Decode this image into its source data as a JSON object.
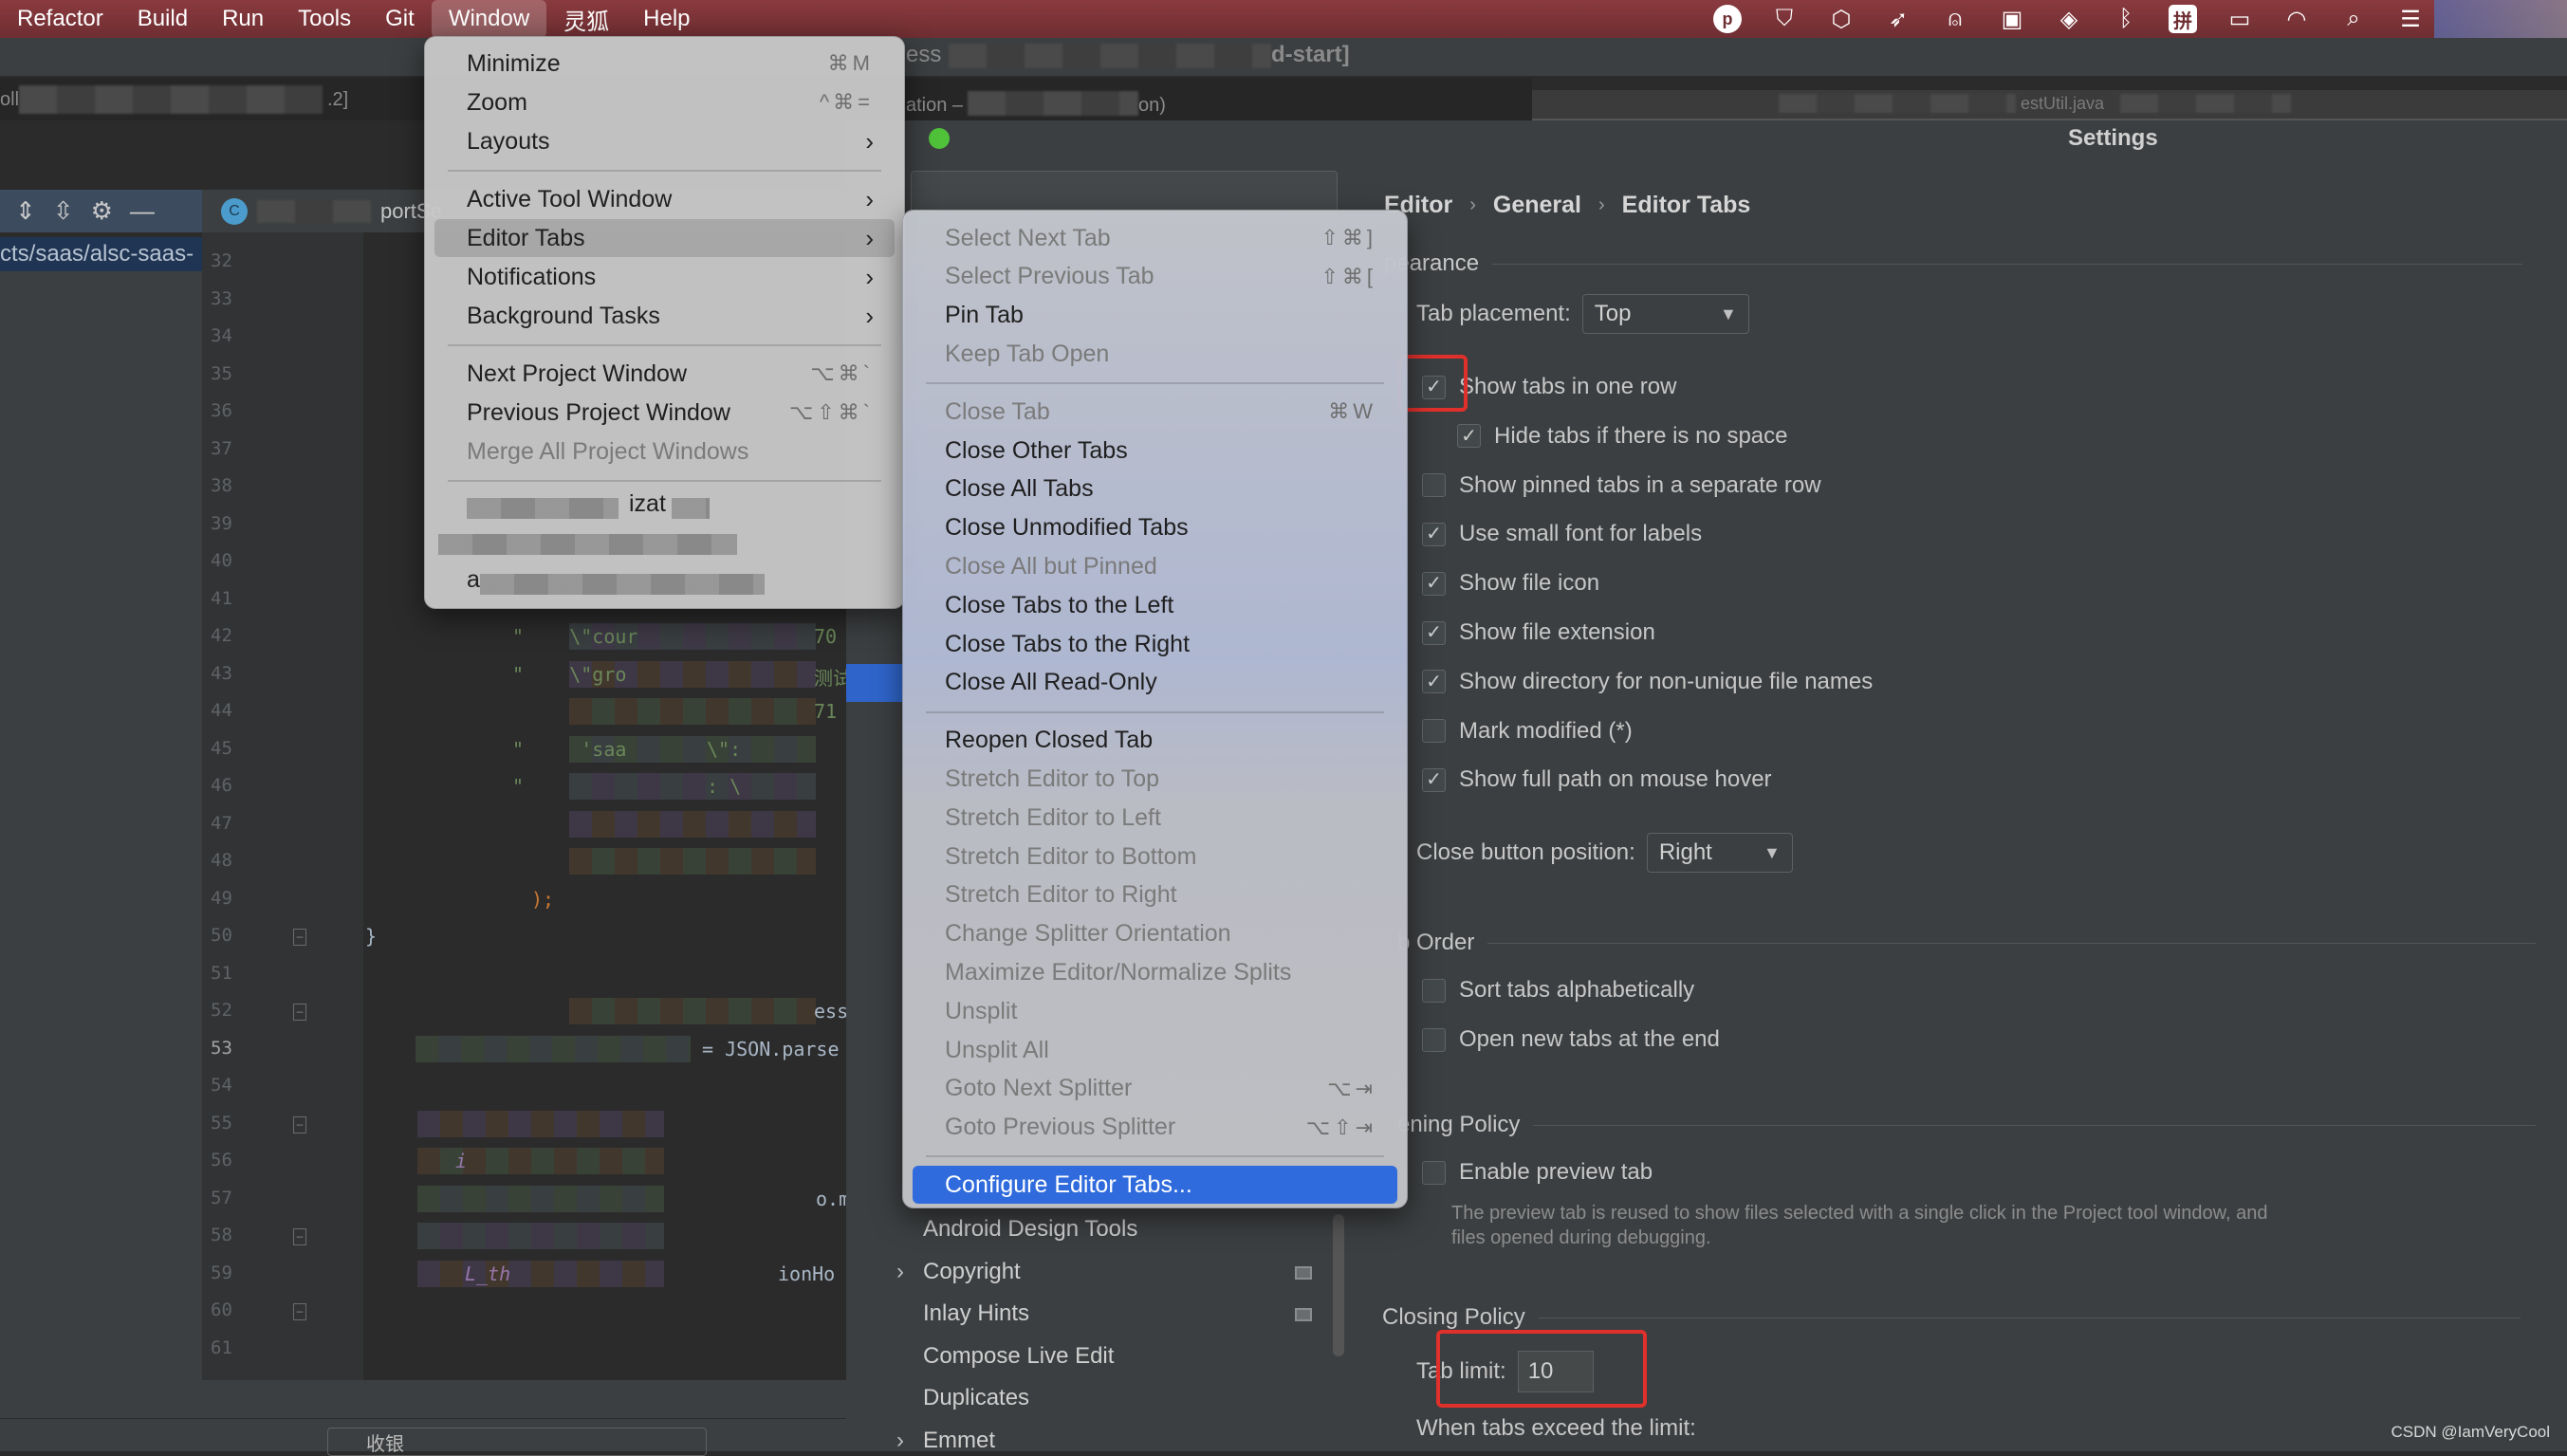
{
  "menubar": {
    "items": [
      "Refactor",
      "Build",
      "Run",
      "Tools",
      "Git",
      "Window",
      "灵狐",
      "Help"
    ],
    "active": "Window",
    "status_icons": [
      "p-badge-icon",
      "shield-icon",
      "hexagon-icon",
      "feather-icon",
      "notification-icon",
      "terminal-icon",
      "vpn-icon",
      "bluetooth-icon",
      "input-method-icon",
      "battery-icon",
      "wifi-icon",
      "search-icon",
      "control-center-icon"
    ],
    "input_method_glyph": "拼"
  },
  "ide": {
    "title_suffix": "d-start]",
    "title_prefix": "ess",
    "tab_title_fragment": ".2]",
    "tab_title_prefix": "oll",
    "second_title": "ation –",
    "second_title_end": "on)",
    "right_title_fragment": "estUtil.java",
    "project_path": "cts/saas/alsc-saas-",
    "editor_tab_label": "portSe",
    "class_badge": "C"
  },
  "code": {
    "lines": [
      {
        "n": "32"
      },
      {
        "n": "33"
      },
      {
        "n": "34"
      },
      {
        "n": "35"
      },
      {
        "n": "36"
      },
      {
        "n": "37"
      },
      {
        "n": "38"
      },
      {
        "n": "39"
      },
      {
        "n": "40"
      },
      {
        "n": "41"
      },
      {
        "n": "42",
        "frag": "\"    \\\"cour",
        "tail": "70"
      },
      {
        "n": "43",
        "frag": "\"    \\\"gro",
        "tail": "测试"
      },
      {
        "n": "44",
        "tail": "71"
      },
      {
        "n": "45",
        "frag": "\"     'saa",
        "mid": "\\\":"
      },
      {
        "n": "46",
        "frag": "\"",
        "mid": ": \\"
      },
      {
        "n": "47"
      },
      {
        "n": "48"
      },
      {
        "n": "49",
        "frag": ");"
      },
      {
        "n": "50",
        "frag": "}"
      },
      {
        "n": "51"
      },
      {
        "n": "52",
        "tail": "ess"
      },
      {
        "n": "53",
        "frag": "= JSON.parse"
      },
      {
        "n": "54"
      },
      {
        "n": "55"
      },
      {
        "n": "56",
        "frag": "i"
      },
      {
        "n": "57",
        "tail": "o.m"
      },
      {
        "n": "58"
      },
      {
        "n": "59",
        "frag": "L_th",
        "tail": "ionHo"
      },
      {
        "n": "60"
      },
      {
        "n": "61"
      }
    ],
    "current_line": "53"
  },
  "find_bar": {
    "query": "收银"
  },
  "window_menu": {
    "items": [
      {
        "label": "Minimize",
        "shortcut": "⌘M"
      },
      {
        "label": "Zoom",
        "shortcut": "^⌘="
      },
      {
        "label": "Layouts",
        "submenu": true
      },
      {
        "sep": true
      },
      {
        "label": "Active Tool Window",
        "submenu": true
      },
      {
        "label": "Editor Tabs",
        "submenu": true,
        "highlighted": true
      },
      {
        "label": "Notifications",
        "submenu": true
      },
      {
        "label": "Background Tasks",
        "submenu": true
      },
      {
        "sep": true
      },
      {
        "label": "Next Project Window",
        "shortcut": "⌥⌘`"
      },
      {
        "label": "Previous Project Window",
        "shortcut": "⌥⇧⌘`"
      },
      {
        "label": "Merge All Project Windows",
        "disabled": true
      },
      {
        "sep": true
      }
    ],
    "blurred_window_fragment": "izat",
    "blurred_window_prefix": "a"
  },
  "editor_tabs_menu": {
    "items": [
      {
        "label": "Select Next Tab",
        "shortcut": "⇧⌘]",
        "disabled": true
      },
      {
        "label": "Select Previous Tab",
        "shortcut": "⇧⌘[",
        "disabled": true
      },
      {
        "label": "Pin Tab"
      },
      {
        "label": "Keep Tab Open",
        "disabled": true
      },
      {
        "sep": true
      },
      {
        "label": "Close Tab",
        "shortcut": "⌘W",
        "disabled": true
      },
      {
        "label": "Close Other Tabs"
      },
      {
        "label": "Close All Tabs"
      },
      {
        "label": "Close Unmodified Tabs"
      },
      {
        "label": "Close All but Pinned",
        "disabled": true
      },
      {
        "label": "Close Tabs to the Left"
      },
      {
        "label": "Close Tabs to the Right"
      },
      {
        "label": "Close All Read-Only"
      },
      {
        "sep": true
      },
      {
        "label": "Reopen Closed Tab"
      },
      {
        "label": "Stretch Editor to Top",
        "disabled": true
      },
      {
        "label": "Stretch Editor to Left",
        "disabled": true
      },
      {
        "label": "Stretch Editor to Bottom",
        "disabled": true
      },
      {
        "label": "Stretch Editor to Right",
        "disabled": true
      },
      {
        "label": "Change Splitter Orientation",
        "disabled": true
      },
      {
        "label": "Maximize Editor/Normalize Splits",
        "disabled": true
      },
      {
        "label": "Unsplit",
        "disabled": true
      },
      {
        "label": "Unsplit All",
        "disabled": true
      },
      {
        "label": "Goto Next Splitter",
        "shortcut": "⌥⇥",
        "disabled": true
      },
      {
        "label": "Goto Previous Splitter",
        "shortcut": "⌥⇧⇥",
        "disabled": true
      },
      {
        "sep": true
      },
      {
        "label": "Configure Editor Tabs...",
        "selected": true
      }
    ]
  },
  "settings": {
    "window_title": "Settings",
    "breadcrumb": [
      "Editor",
      "General",
      "Editor Tabs"
    ],
    "tree": [
      {
        "label": "Android Design Tools"
      },
      {
        "label": "Copyright",
        "expandable": true,
        "badge": true
      },
      {
        "label": "Inlay Hints",
        "badge": true
      },
      {
        "label": "Compose Live Edit"
      },
      {
        "label": "Duplicates"
      },
      {
        "label": "Emmet",
        "expandable": true
      }
    ],
    "appearance": {
      "title": "pearance",
      "tab_placement_label": "Tab placement:",
      "tab_placement_value": "Top",
      "options": [
        {
          "label": "Show tabs in one row",
          "checked": true
        },
        {
          "label": "Hide tabs if there is no space",
          "checked": true,
          "indent": true
        },
        {
          "label": "Show pinned tabs in a separate row",
          "checked": false
        },
        {
          "label": "Use small font for labels",
          "checked": true
        },
        {
          "label": "Show file icon",
          "checked": true
        },
        {
          "label": "Show file extension",
          "checked": true
        },
        {
          "label": "Show directory for non-unique file names",
          "checked": true
        },
        {
          "label": "Mark modified (*)",
          "checked": false
        },
        {
          "label": "Show full path on mouse hover",
          "checked": true
        }
      ],
      "close_button_label": "Close button position:",
      "close_button_value": "Right"
    },
    "tab_order": {
      "title": "b Order",
      "options": [
        {
          "label": "Sort tabs alphabetically",
          "checked": false
        },
        {
          "label": "Open new tabs at the end",
          "checked": false
        }
      ]
    },
    "opening_policy": {
      "title": "ening Policy",
      "preview_label": "Enable preview tab",
      "preview_checked": false,
      "hint": "The preview tab is reused to show files selected with a single click in the Project tool window, and files opened during debugging."
    },
    "closing_policy": {
      "title": "Closing Policy",
      "tab_limit_label": "Tab limit:",
      "tab_limit_value": "10",
      "exceed_label": "When tabs exceed the limit:"
    }
  },
  "watermark": "CSDN @IamVeryCool",
  "colors": {
    "highlight": "#e0302b",
    "menu_selected": "#2f6bdc",
    "traffic_green": "#4fc23a"
  }
}
